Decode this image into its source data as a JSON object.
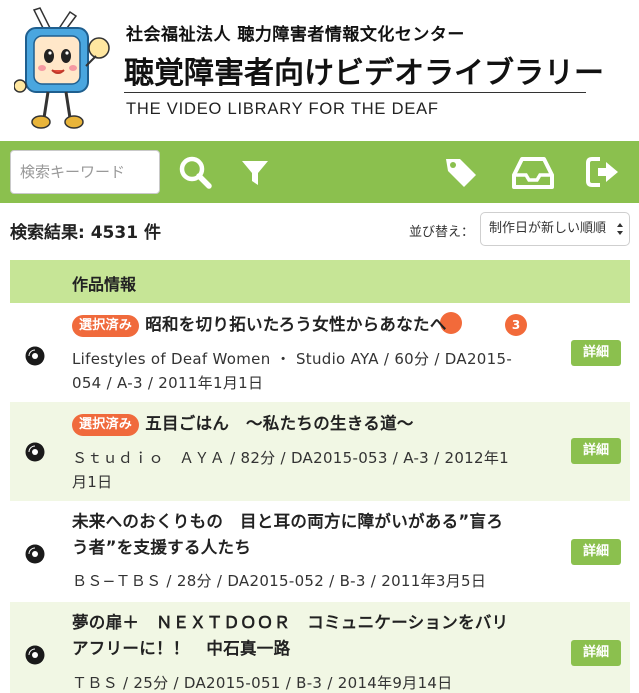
{
  "header": {
    "org_name": "社会福祉法人 聴力障害者情報文化センター",
    "site_title": "聴覚障害者向けビデオライブラリー",
    "subtitle_en": "THE VIDEO LIBRARY FOR THE DEAF"
  },
  "toolbar": {
    "search_placeholder": "検索キーワード",
    "search_value": "",
    "icons": [
      "search-icon",
      "filter-icon",
      "tag-icon",
      "tray-icon",
      "logout-icon"
    ],
    "tray_badge": "3"
  },
  "results": {
    "count_text": "検索結果: 4531 件",
    "sort_label": "並び替え：",
    "sort_value": "制作日が新しい順順"
  },
  "table": {
    "column_header": "作品情報",
    "detail_label": "詳細",
    "selected_label": "選択済み",
    "rows": [
      {
        "selected": true,
        "title": "昭和を切り拓いたろう女性からあなたへ",
        "meta_line1": "Lifestyles of Deaf Women ・ Studio AYA / 60分 / DA2015-",
        "meta_line2": "054 / A-3 / 2011年1月1日"
      },
      {
        "selected": true,
        "title": "五目ごはん　〜私たちの生きる道〜",
        "meta_line1": "Ｓｔｕｄｉｏ　ＡＹＡ / 82分 / DA2015-053 / A-3 / 2012年1",
        "meta_line2": "月1日"
      },
      {
        "selected": false,
        "title_line1": "未来へのおくりもの　目と耳の両方に障がいがある”盲ろ",
        "title_line2": "う者”を支援する人たち",
        "meta_line1": "ＢＳ−ＴＢＳ / 28分 / DA2015-052 / B-3 / 2011年3月5日"
      },
      {
        "selected": false,
        "title_line1": "夢の扉＋　ＮＥＸＴＤＯＯＲ　コミュニケーションをバリ",
        "title_line2": "アフリーに！！　中石真一路",
        "meta_line1": "ＴＢＳ / 25分 / DA2015-051 / B-3 / 2014年9月14日"
      }
    ]
  },
  "colors": {
    "brand_green": "#8bc04e",
    "header_green": "#c6e596",
    "alt_row": "#f1f7e4",
    "accent_orange": "#f06a3c"
  }
}
